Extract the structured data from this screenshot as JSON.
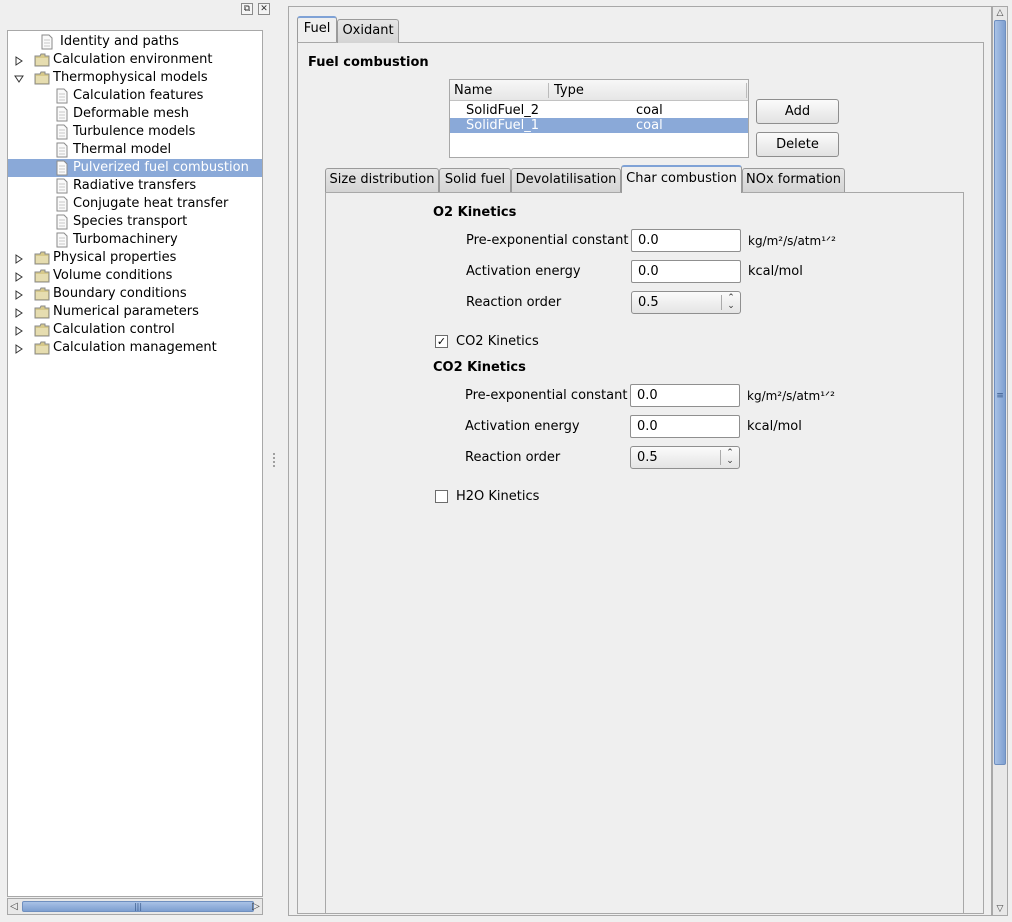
{
  "dock": {
    "float_glyph": "⧉",
    "close_glyph": "✕"
  },
  "tree": {
    "items": [
      {
        "label": "Identity and paths",
        "level": 1,
        "icon": "document-icon",
        "expandable": false,
        "expanded": false,
        "selected": false
      },
      {
        "label": "Calculation environment",
        "level": 0,
        "icon": "folder-icon",
        "expandable": true,
        "expanded": false,
        "selected": false
      },
      {
        "label": "Thermophysical models",
        "level": 0,
        "icon": "folder-icon",
        "expandable": true,
        "expanded": true,
        "selected": false
      },
      {
        "label": "Calculation features",
        "level": 2,
        "icon": "document-icon",
        "expandable": false,
        "expanded": false,
        "selected": false
      },
      {
        "label": "Deformable mesh",
        "level": 2,
        "icon": "document-icon",
        "expandable": false,
        "expanded": false,
        "selected": false
      },
      {
        "label": "Turbulence models",
        "level": 2,
        "icon": "document-icon",
        "expandable": false,
        "expanded": false,
        "selected": false
      },
      {
        "label": "Thermal model",
        "level": 2,
        "icon": "document-icon",
        "expandable": false,
        "expanded": false,
        "selected": false
      },
      {
        "label": "Pulverized fuel combustion",
        "level": 2,
        "icon": "document-icon",
        "expandable": false,
        "expanded": false,
        "selected": true
      },
      {
        "label": "Radiative transfers",
        "level": 2,
        "icon": "document-icon",
        "expandable": false,
        "expanded": false,
        "selected": false
      },
      {
        "label": "Conjugate heat transfer",
        "level": 2,
        "icon": "document-icon",
        "expandable": false,
        "expanded": false,
        "selected": false
      },
      {
        "label": "Species transport",
        "level": 2,
        "icon": "document-icon",
        "expandable": false,
        "expanded": false,
        "selected": false
      },
      {
        "label": "Turbomachinery",
        "level": 2,
        "icon": "document-icon",
        "expandable": false,
        "expanded": false,
        "selected": false
      },
      {
        "label": "Physical properties",
        "level": 0,
        "icon": "folder-icon",
        "expandable": true,
        "expanded": false,
        "selected": false
      },
      {
        "label": "Volume conditions",
        "level": 0,
        "icon": "folder-icon",
        "expandable": true,
        "expanded": false,
        "selected": false
      },
      {
        "label": "Boundary conditions",
        "level": 0,
        "icon": "folder-icon",
        "expandable": true,
        "expanded": false,
        "selected": false
      },
      {
        "label": "Numerical parameters",
        "level": 0,
        "icon": "folder-icon",
        "expandable": true,
        "expanded": false,
        "selected": false
      },
      {
        "label": "Calculation control",
        "level": 0,
        "icon": "folder-icon",
        "expandable": true,
        "expanded": false,
        "selected": false
      },
      {
        "label": "Calculation management",
        "level": 0,
        "icon": "folder-icon",
        "expandable": true,
        "expanded": false,
        "selected": false
      }
    ]
  },
  "hscroll": {
    "thumb_glyph": "|||",
    "left_glyph": "◁",
    "right_glyph": "▷"
  },
  "vscroll": {
    "thumb_glyph": "≡",
    "up_glyph": "△",
    "down_glyph": "▽"
  },
  "outer_tabs": [
    {
      "label": "Fuel",
      "active": true
    },
    {
      "label": "Oxidant",
      "active": false
    }
  ],
  "fuel": {
    "title": "Fuel combustion",
    "table": {
      "columns": [
        "Name",
        "Type"
      ],
      "rows": [
        {
          "name": "SolidFuel_2",
          "type": "coal",
          "selected": false
        },
        {
          "name": "SolidFuel_1",
          "type": "coal",
          "selected": true
        }
      ]
    },
    "add_label": "Add",
    "delete_label": "Delete"
  },
  "inner_tabs": [
    {
      "label": "Size distribution",
      "active": false
    },
    {
      "label": "Solid fuel",
      "active": false
    },
    {
      "label": "Devolatilisation",
      "active": false
    },
    {
      "label": "Char combustion",
      "active": true
    },
    {
      "label": "NOx formation",
      "active": false
    }
  ],
  "o2": {
    "title": "O2 Kinetics",
    "pre_exp_label": "Pre-exponential constant",
    "pre_exp_value": "0.0",
    "pre_exp_unit": "kg/m²/s/atm¹ᐟ²",
    "act_label": "Activation energy",
    "act_value": "0.0",
    "act_unit": "kcal/mol",
    "order_label": "Reaction order",
    "order_value": "0.5"
  },
  "co2_checkbox": {
    "label": "CO2 Kinetics",
    "checked": true,
    "mark": "✓"
  },
  "co2": {
    "title": "CO2 Kinetics",
    "pre_exp_label": "Pre-exponential constant",
    "pre_exp_value": "0.0",
    "pre_exp_unit": "kg/m²/s/atm¹ᐟ²",
    "act_label": "Activation energy",
    "act_value": "0.0",
    "act_unit": "kcal/mol",
    "order_label": "Reaction order",
    "order_value": "0.5"
  },
  "h2o_checkbox": {
    "label": "H2O Kinetics",
    "checked": false
  },
  "combo_glyph": {
    "up": "⌃",
    "down": "⌄"
  },
  "colors": {
    "selection": "#8aa9d8",
    "tab_accent": "#7fa2d6",
    "folder": "#d7c98a"
  }
}
